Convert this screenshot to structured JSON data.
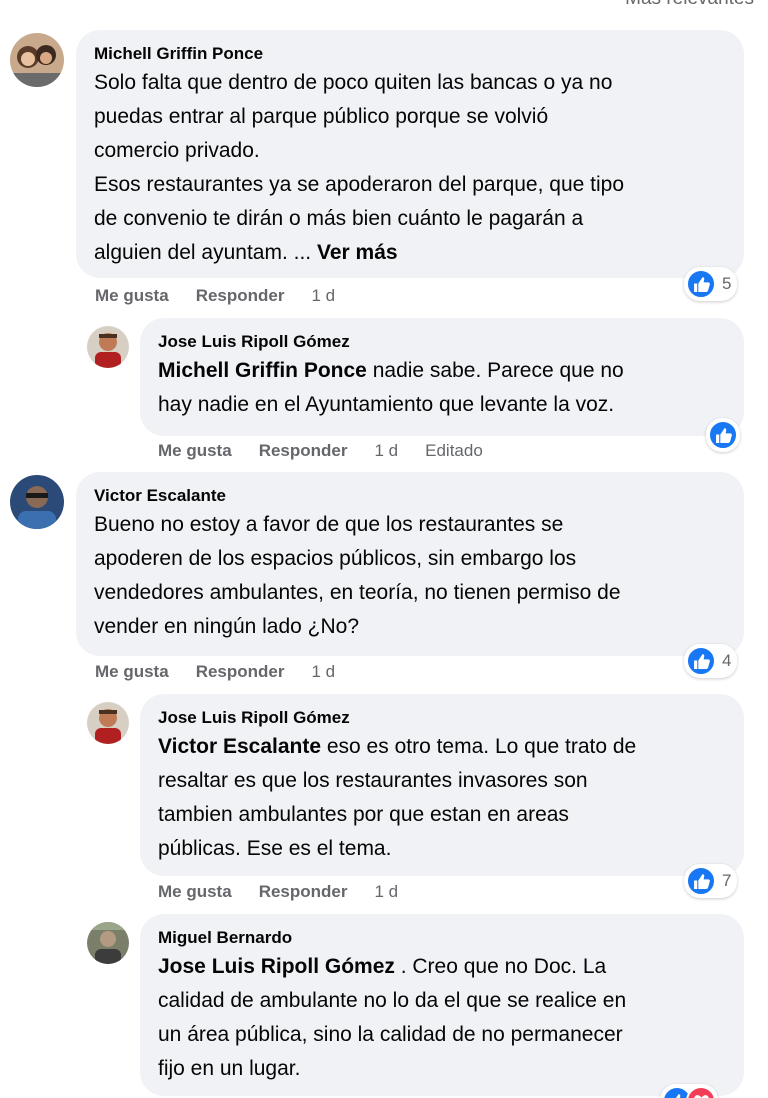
{
  "sort_label": "Más relevantes",
  "colors": {
    "bubble": "#f0f2f5",
    "like_blue": "#1877f2",
    "muted": "#65676b",
    "love_red": "#f33e58"
  },
  "comments": [
    {
      "author": "Michell Griffin Ponce",
      "lines": [
        "Solo falta que dentro de poco quiten las bancas o ya no",
        "puedas entrar al parque público porque se volvió",
        "comercio privado.",
        "Esos restaurantes ya se apoderaron del parque, que tipo",
        "de convenio te dirán o más bien cuánto le pagarán a",
        "alguien del ayuntam. ..."
      ],
      "see_more": "Ver más",
      "like": "Me gusta",
      "reply": "Responder",
      "time": "1 d",
      "reactions": "5"
    },
    {
      "author": "Jose Luis Ripoll Gómez",
      "mention": "Michell Griffin Ponce",
      "line1_rest": " nadie sabe. Parece que no",
      "line2": "hay nadie en el Ayuntamiento que levante la voz.",
      "like": "Me gusta",
      "reply": "Responder",
      "time": "1 d",
      "edited": "Editado"
    },
    {
      "author": "Victor Escalante",
      "lines": [
        "Bueno no estoy a favor de que los restaurantes se",
        "apoderen de los espacios públicos, sin embargo los",
        "vendedores ambulantes, en teoría, no tienen permiso de",
        "vender en ningún lado ¿No?"
      ],
      "like": "Me gusta",
      "reply": "Responder",
      "time": "1 d",
      "reactions": "4"
    },
    {
      "author": "Jose Luis Ripoll Gómez",
      "mention": "Victor Escalante",
      "line1_rest": " eso es otro tema. Lo que trato de",
      "lines": [
        "resaltar es que los restaurantes invasores son",
        "tambien ambulantes por que estan en areas",
        "públicas. Ese es el tema."
      ],
      "like": "Me gusta",
      "reply": "Responder",
      "time": "1 d",
      "reactions": "7"
    },
    {
      "author": "Miguel Bernardo",
      "mention": "Jose Luis Ripoll Gómez",
      "line1_rest": " . Creo que no Doc. La",
      "lines": [
        "calidad de ambulante no lo da el que se realice en",
        "un área pública, sino la calidad de no permanecer",
        "fijo en un lugar."
      ]
    }
  ],
  "icons": {
    "like": "thumbs-up-icon",
    "love": "heart-icon"
  }
}
